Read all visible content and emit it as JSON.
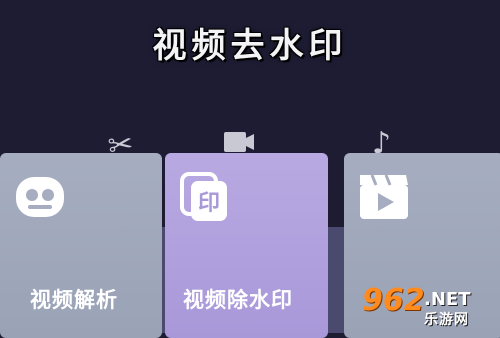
{
  "header": {
    "title": "视频去水印"
  },
  "background_icons": [
    "scissors-icon",
    "film-icon",
    "music-note-icon"
  ],
  "cards": [
    {
      "label": "视频解析",
      "icon": "video-parse-icon",
      "color": "#a6adc0"
    },
    {
      "label": "视频除水印",
      "icon": "remove-watermark-icon",
      "color": "#b8a9e2"
    },
    {
      "label": "",
      "icon": "video-clapper-icon",
      "color": "#a6adc0"
    }
  ],
  "watermark": {
    "number": "962",
    "suffix": ".NET",
    "site_name": "乐游网"
  }
}
